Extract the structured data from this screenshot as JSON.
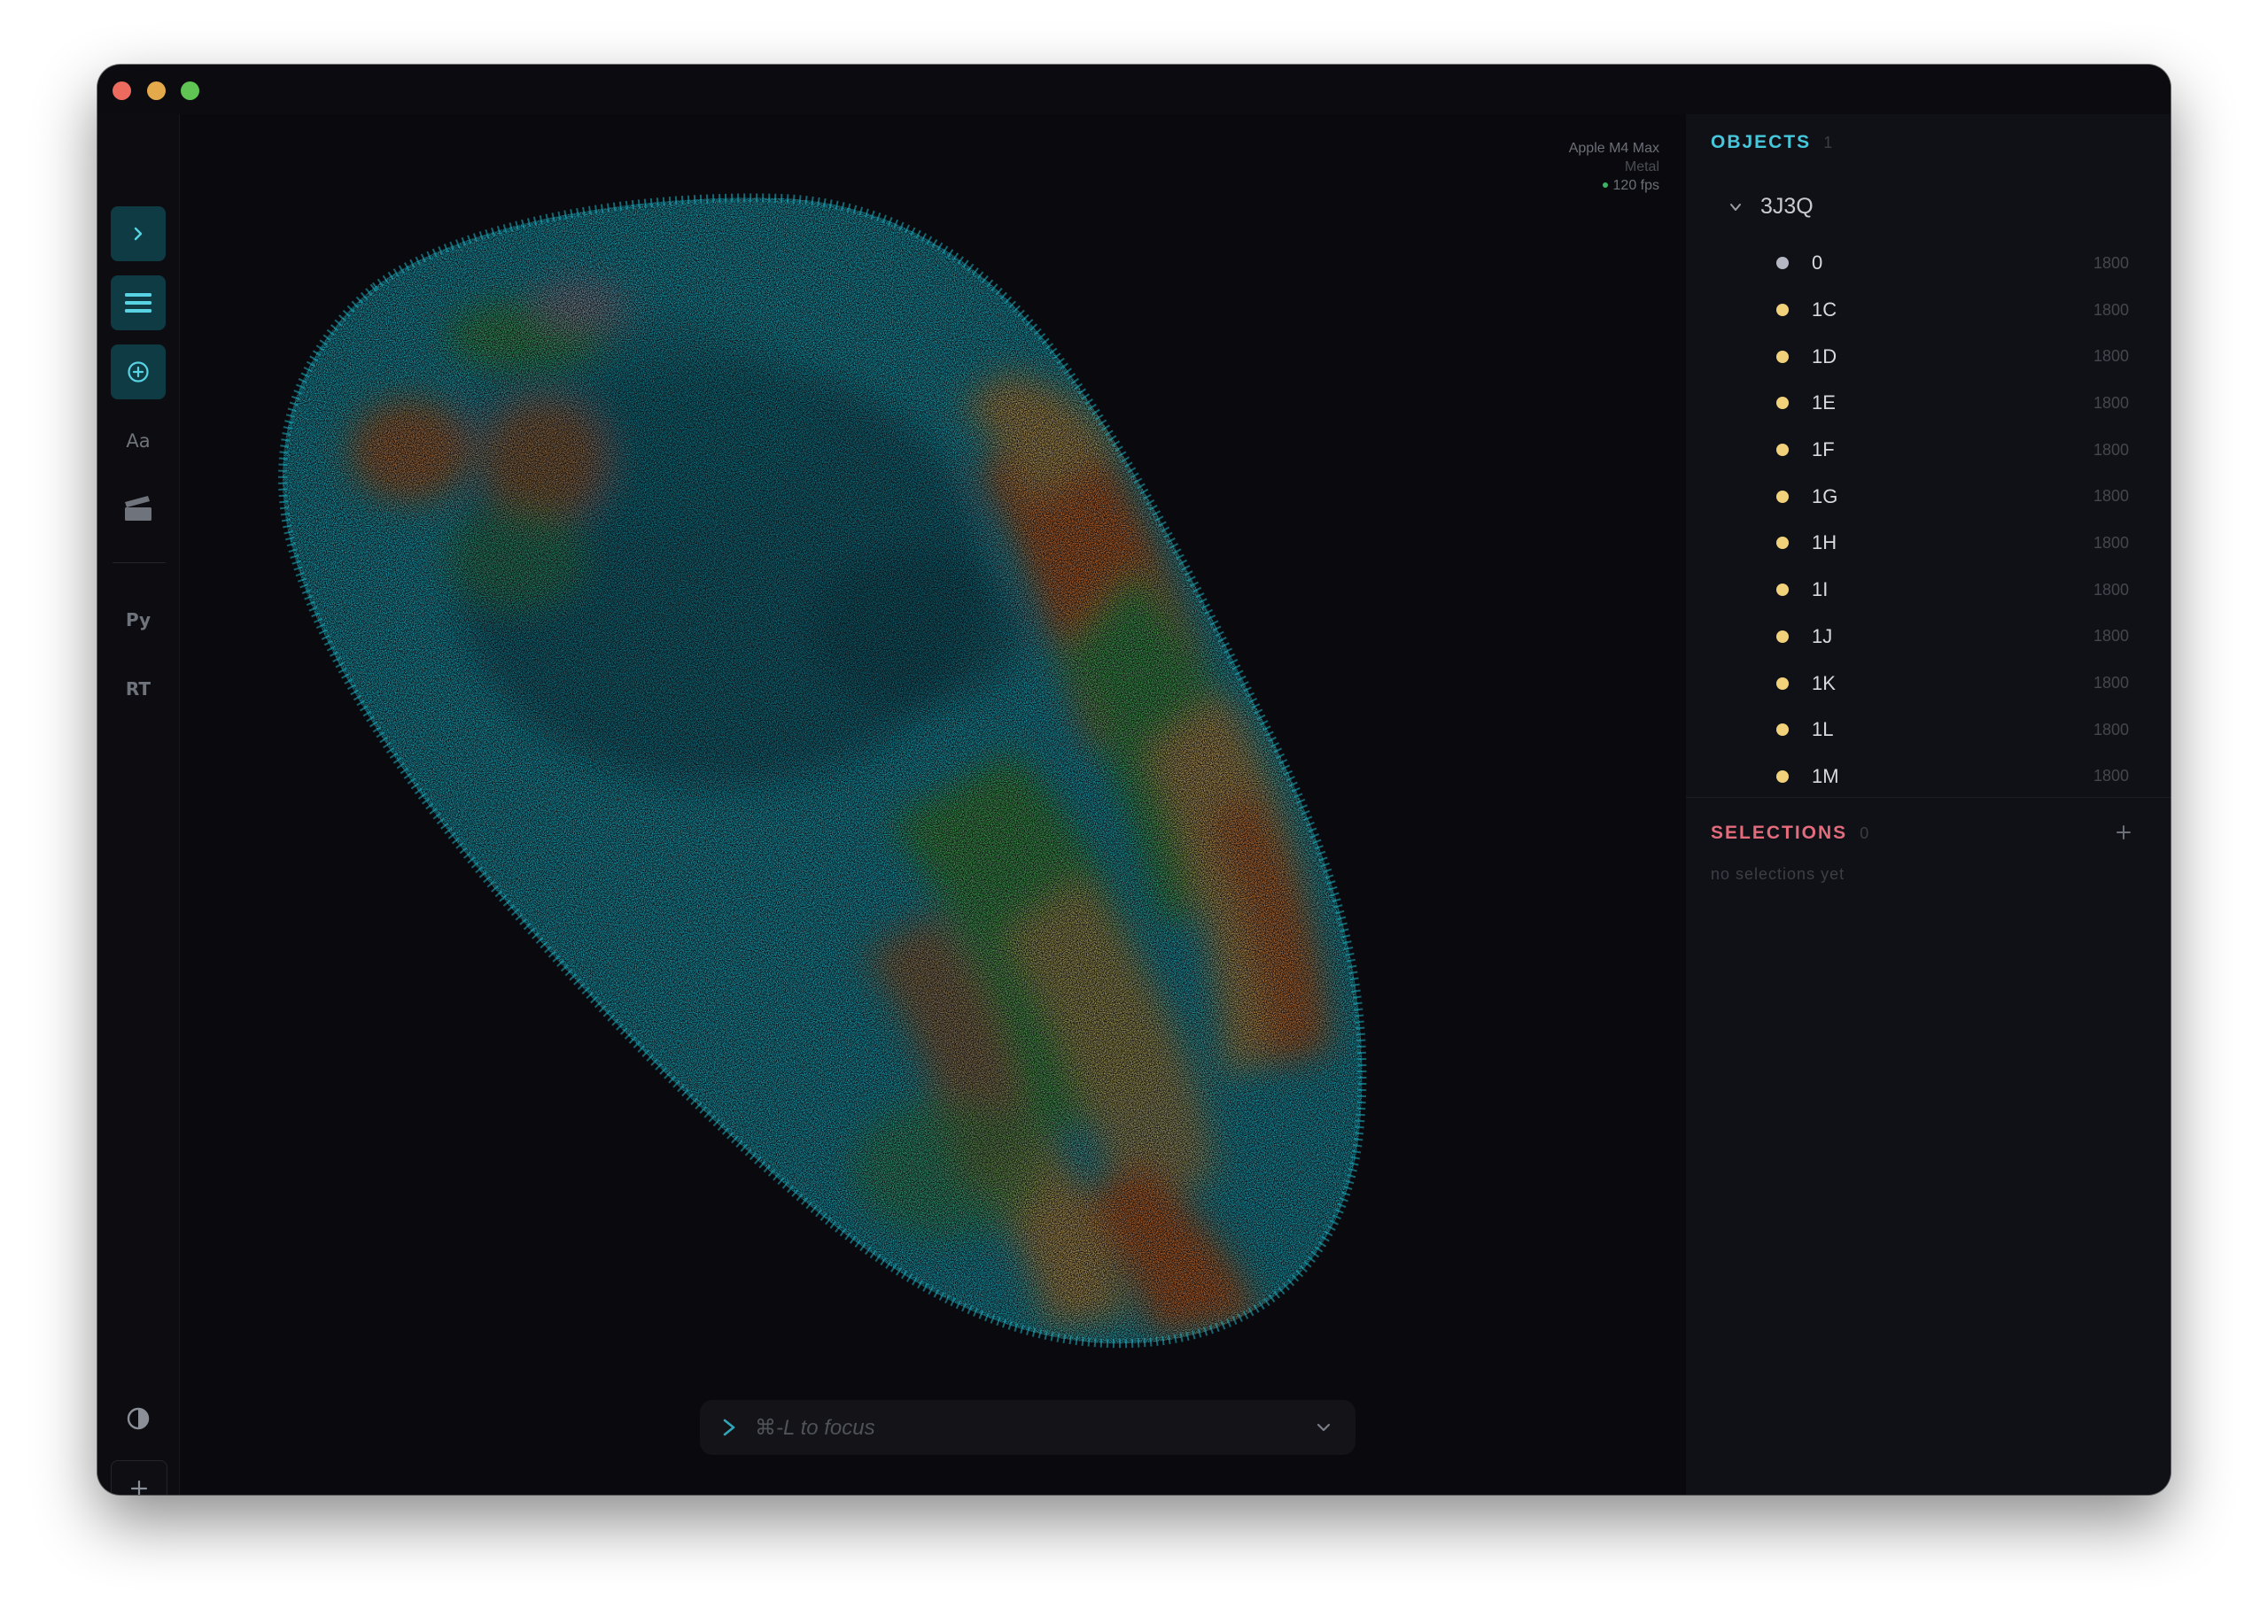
{
  "window": {
    "traffic_lights": {
      "close": "#ed6a5e",
      "minimize": "#e3a94b",
      "zoom": "#5fc454"
    }
  },
  "rail": {
    "items": [
      {
        "id": "expand",
        "icon": "chevron-right-icon"
      },
      {
        "id": "objects",
        "icon": "list-icon",
        "active": true
      },
      {
        "id": "add",
        "icon": "plus-circle-icon"
      },
      {
        "id": "text",
        "label": "Aa"
      },
      {
        "id": "movie",
        "icon": "clapperboard-icon"
      },
      {
        "id": "python",
        "label": "Py"
      },
      {
        "id": "raytrace",
        "label": "RT"
      }
    ],
    "bottom": [
      {
        "id": "theme",
        "icon": "contrast-icon"
      },
      {
        "id": "new",
        "icon": "plus-icon"
      }
    ],
    "text_label": "Aa",
    "python_label": "Py",
    "rt_label": "RT"
  },
  "viewport": {
    "gpu_name": "Apple M4 Max",
    "backend": "Metal",
    "fps": "120 fps",
    "command_placeholder": "⌘-L to focus",
    "colors": {
      "background": "#0a0a0e",
      "cyan": "#1aa3b4",
      "orange": "#c2682a",
      "green": "#3fa04f",
      "tan": "#b99b55",
      "grey": "#8a8da0"
    }
  },
  "objects": {
    "title": "OBJECTS",
    "count": "1",
    "model": "3J3Q",
    "chains": [
      {
        "name": "0",
        "count": "1800",
        "color": "#b5b8c4"
      },
      {
        "name": "1C",
        "count": "1800",
        "color": "#f1d27a"
      },
      {
        "name": "1D",
        "count": "1800",
        "color": "#f1d27a"
      },
      {
        "name": "1E",
        "count": "1800",
        "color": "#f1d27a"
      },
      {
        "name": "1F",
        "count": "1800",
        "color": "#f1d27a"
      },
      {
        "name": "1G",
        "count": "1800",
        "color": "#f1d27a"
      },
      {
        "name": "1H",
        "count": "1800",
        "color": "#f1d27a"
      },
      {
        "name": "1I",
        "count": "1800",
        "color": "#f1d27a"
      },
      {
        "name": "1J",
        "count": "1800",
        "color": "#f1d27a"
      },
      {
        "name": "1K",
        "count": "1800",
        "color": "#f1d27a"
      },
      {
        "name": "1L",
        "count": "1800",
        "color": "#f1d27a"
      },
      {
        "name": "1M",
        "count": "1800",
        "color": "#f1d27a"
      }
    ]
  },
  "selections": {
    "title": "SELECTIONS",
    "count": "0",
    "empty_text": "no selections yet"
  }
}
